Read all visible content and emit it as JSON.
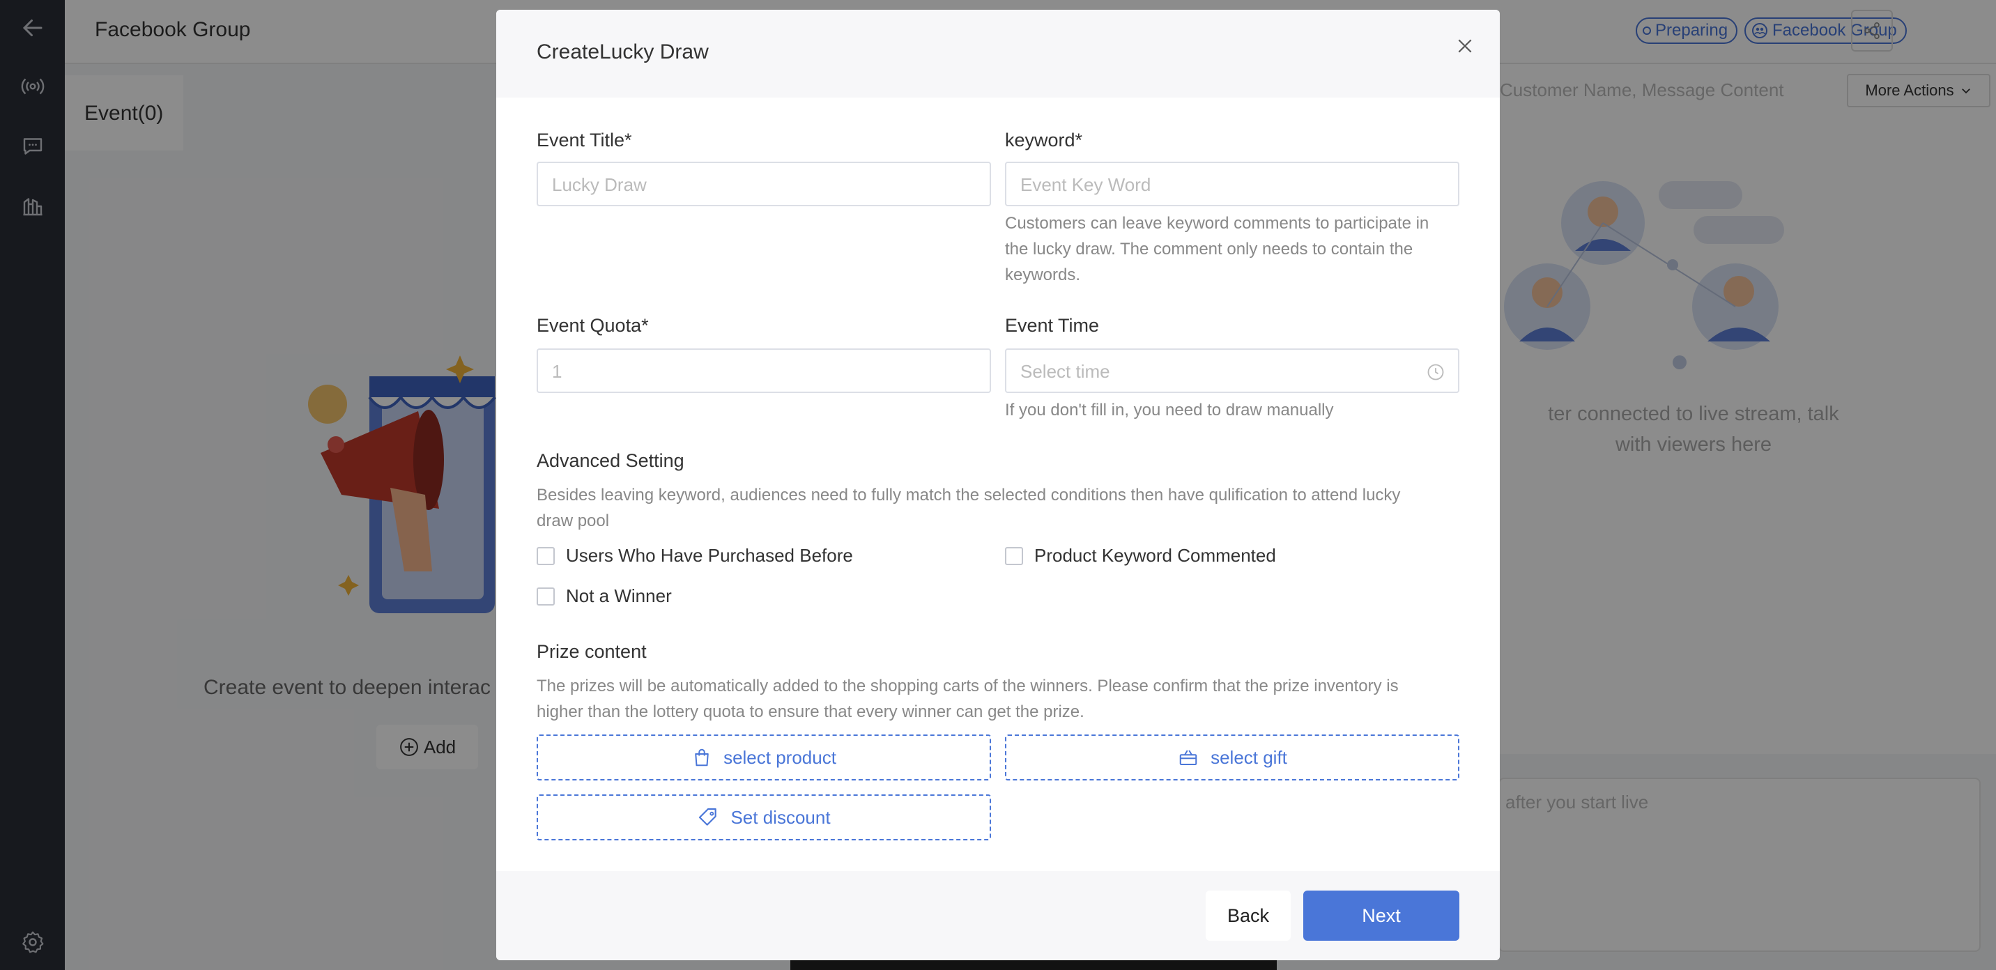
{
  "header": {
    "title": "Facebook Group",
    "status_badge": "Preparing",
    "platform_badge": "Facebook Group"
  },
  "rail": {
    "items": [
      "back-icon",
      "live-broadcast-icon",
      "chat-icon",
      "stats-icon",
      "settings-icon"
    ]
  },
  "left": {
    "event_tab": "Event(0)",
    "empty_text": "Create event to deepen interac",
    "add_label": "Add"
  },
  "right": {
    "search_placeholder": "Customer Name, Message Content",
    "more_actions": "More Actions",
    "empty_line1": "ter connected to live stream, talk",
    "empty_line2": "with viewers here",
    "comment_placeholder": "after you start live"
  },
  "modal": {
    "title": "CreateLucky Draw",
    "event_title_label": "Event Title*",
    "event_title_placeholder": "Lucky Draw",
    "keyword_label": "keyword*",
    "keyword_placeholder": "Event Key Word",
    "keyword_hint_1": "Customers can leave keyword comments to participate in",
    "keyword_hint_2": "the lucky draw. The comment only needs to contain the",
    "keyword_hint_3": "keywords.",
    "quota_label": "Event Quota*",
    "quota_placeholder": "1",
    "time_label": "Event Time",
    "time_placeholder": "Select time",
    "time_hint": "If you don't fill in, you need to draw manually",
    "advanced_label": "Advanced Setting",
    "advanced_hint_1": "Besides leaving keyword, audiences need to fully match the selected conditions then have qulification to attend lucky",
    "advanced_hint_2": "draw pool",
    "cond_purchased": "Users Who Have Purchased Before",
    "cond_keyword": "Product Keyword Commented",
    "cond_not_winner": "Not a Winner",
    "prize_label": "Prize content",
    "prize_hint_1": "The prizes will be automatically added to the shopping carts of the winners. Please confirm that the prize inventory is",
    "prize_hint_2": "higher than the lottery quota to ensure that every winner can get the prize.",
    "select_product": "select product",
    "select_gift": "select gift",
    "set_discount": "Set discount",
    "back_label": "Back",
    "next_label": "Next"
  },
  "colors": {
    "accent": "#4a76d8",
    "rail_bg": "#2b2f38",
    "overlay": "rgba(0,0,0,0.45)"
  }
}
